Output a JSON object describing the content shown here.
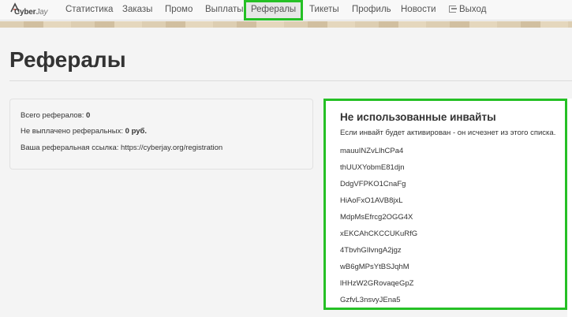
{
  "nav": {
    "brand": {
      "cyber": "Cyber",
      "jay": "Jay"
    },
    "items": [
      {
        "label": "Статистика"
      },
      {
        "label": "Заказы"
      },
      {
        "label": "Промо"
      },
      {
        "label": "Выплаты"
      },
      {
        "label": "Рефералы",
        "active": true
      },
      {
        "label": "Тикеты"
      },
      {
        "label": "Профиль"
      },
      {
        "label": "Новости"
      },
      {
        "label": "Выход",
        "icon": "logout-icon"
      }
    ]
  },
  "page": {
    "title": "Рефералы"
  },
  "stats": {
    "total_label": "Всего рефералов:",
    "total_value": "0",
    "unpaid_label": "Не выплачено реферальных:",
    "unpaid_value": "0 руб.",
    "link_label": "Ваша реферальная ссылка:",
    "link_value": "https://cyberjay.org/registration"
  },
  "invites": {
    "title": "Не использованные инвайты",
    "description": "Если инвайт будет активирован - он исчезнет из этого списка.",
    "codes": [
      "mauuINZvLlhCPa4",
      "thUUXYobmE81djn",
      "DdgVFPKO1CnaFg",
      "HiAoFxO1AVB8jxL",
      "MdpMsEfrcg2OGG4X",
      "xEKCAhCKCCUKuRfG",
      "4TbvhGIlvngA2jgz",
      "wB6gMPsYtBSJqhM",
      "lHHzW2GRovaqeGpZ",
      "GzfvL3nsvyJEna5"
    ]
  },
  "colors": {
    "highlight": "#25c025"
  }
}
